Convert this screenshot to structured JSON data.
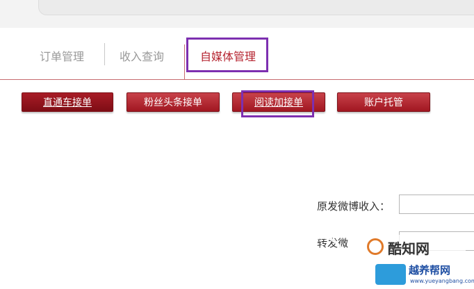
{
  "tabs": [
    {
      "label": "订单管理",
      "active": false
    },
    {
      "label": "收入查询",
      "active": false
    },
    {
      "label": "自媒体管理",
      "active": true
    }
  ],
  "buttons": [
    {
      "label": "直通车接单",
      "active": true
    },
    {
      "label": "粉丝头条接单",
      "active": false
    },
    {
      "label": "阅读加接单",
      "active": false
    },
    {
      "label": "账户托管",
      "active": false
    }
  ],
  "form": {
    "original_income_label": "原发微博收入：",
    "repost_income_label": "转发微"
  },
  "watermark": {
    "logo_text": "酷知网",
    "brand_text": "越养帮网",
    "url": "www.yueyangbang.com"
  },
  "colors": {
    "accent": "#b5232f",
    "button": "#b0202a",
    "highlight_box": "#7d2fb0"
  }
}
